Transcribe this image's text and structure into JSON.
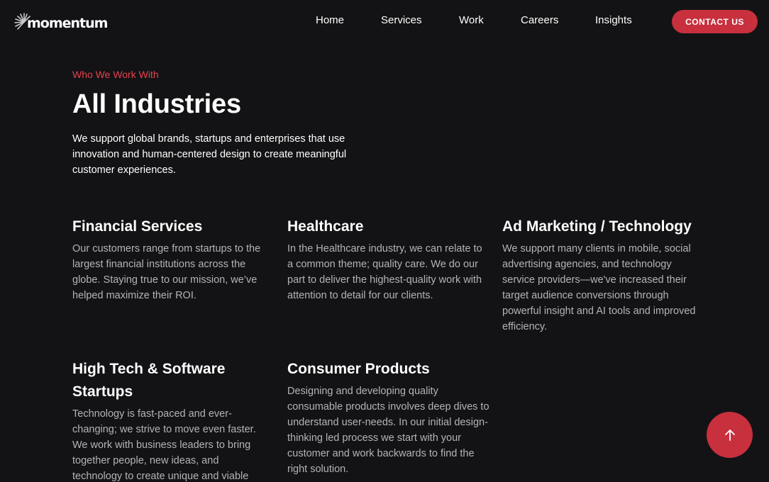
{
  "header": {
    "logo_text": "momentum",
    "nav": [
      {
        "label": "Home"
      },
      {
        "label": "Services"
      },
      {
        "label": "Work"
      },
      {
        "label": "Careers"
      },
      {
        "label": "Insights"
      }
    ],
    "contact_label": "CONTACT US"
  },
  "intro": {
    "eyebrow": "Who We Work With",
    "title": "All Industries",
    "description": "We support global brands, startups and enterprises that use innovation and human-centered design to create meaningful customer experiences."
  },
  "industries": [
    {
      "title": "Financial Services",
      "description": "Our customers range from startups to the largest financial institutions across the globe. Staying true to our mission, we’ve helped maximize their ROI."
    },
    {
      "title": "Healthcare",
      "description": "In the Healthcare industry, we can relate to a common theme; quality care. We do our part to deliver the highest-quality work with attention to detail for our clients."
    },
    {
      "title": "Ad Marketing / Technology",
      "description": "We support many clients in mobile, social advertising agencies, and technology service providers—we've increased their target audience conversions through powerful insight and AI tools and improved efficiency."
    },
    {
      "title": "High Tech & Software Startups",
      "description": "Technology is fast-paced and ever-changing; we strive to move even faster. We work with business leaders to bring together people, new ideas, and technology to create unique and viable"
    },
    {
      "title": "Consumer Products",
      "description": "Designing and developing quality consumable products involves deep dives to understand user-needs. In our initial design-thinking led process we start with your customer and work backwards to find the right solution."
    }
  ],
  "icons": {
    "logo": "sunburst-logo-icon",
    "back_to_top": "arrow-up-icon"
  },
  "colors": {
    "background": "#131315",
    "accent": "#c8303e",
    "eyebrow": "#e8414f",
    "muted_text": "#b4b4b8"
  }
}
